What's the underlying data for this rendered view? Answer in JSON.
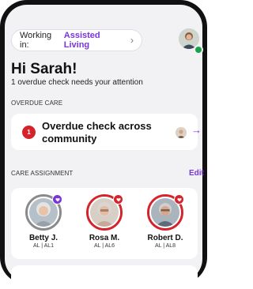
{
  "context": {
    "label": "Working in:",
    "value": "Assisted Living",
    "chevron": "›"
  },
  "user": {
    "avatar_icon": "user-avatar",
    "status": "online"
  },
  "greeting": "Hi Sarah!",
  "subtext": "1 overdue check needs your attention",
  "overdue": {
    "section_label": "OVERDUE CARE",
    "count": "1",
    "title": "Overdue check across community",
    "arrow": "→"
  },
  "assignment": {
    "section_label": "CARE ASSIGNMENT",
    "edit_label": "Edit",
    "residents": [
      {
        "name": "Betty J.",
        "location": "AL | AL1",
        "ring_color": "#888888",
        "badge_color": "#7a35d8",
        "badge_icon": "heart-icon"
      },
      {
        "name": "Rosa M.",
        "location": "AL | AL6",
        "ring_color": "#d6232b",
        "badge_color": "#d6232b",
        "badge_icon": "heart-icon"
      },
      {
        "name": "Robert D.",
        "location": "AL | AL8",
        "ring_color": "#d6232b",
        "badge_color": "#d6232b",
        "badge_icon": "heart-icon"
      }
    ]
  },
  "colors": {
    "accent": "#7a35d8",
    "alert": "#d6232b",
    "online": "#17a34a"
  }
}
